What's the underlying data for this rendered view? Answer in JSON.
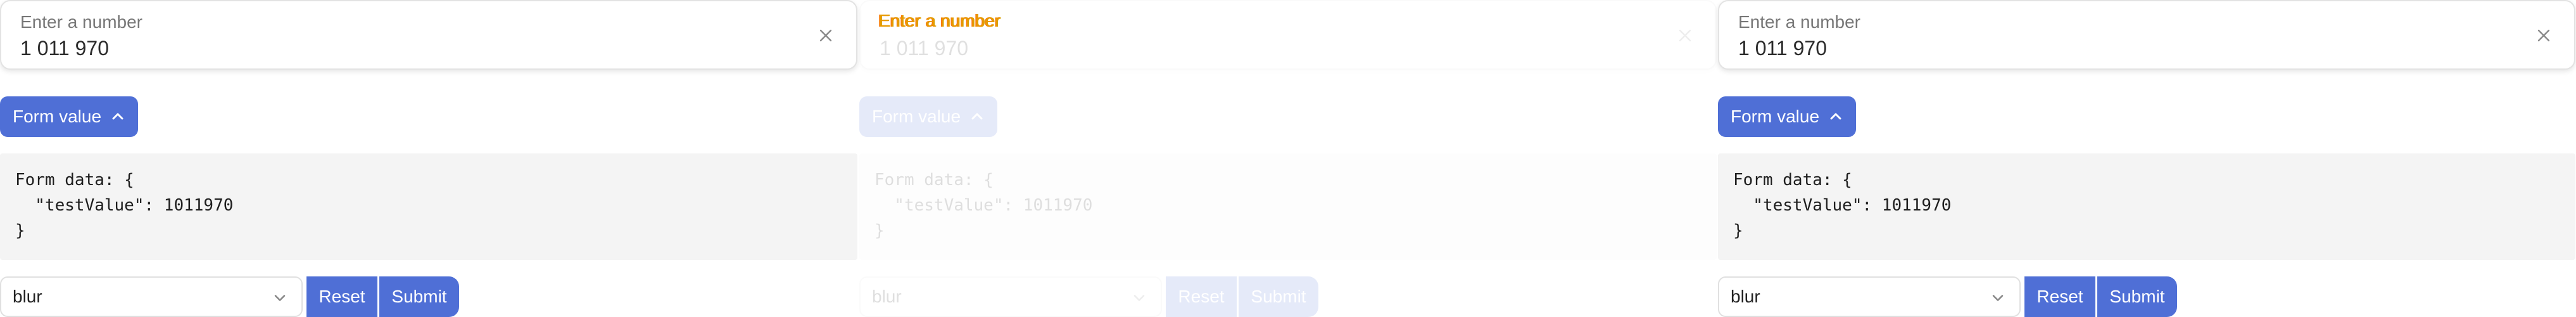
{
  "field": {
    "label": "Enter a number",
    "value": "1 011 970"
  },
  "toggle": {
    "label": "Form value"
  },
  "code": {
    "text": "Form data: {\n  \"testValue\": 1011970\n}"
  },
  "select": {
    "value": "blur"
  },
  "buttons": {
    "reset": "Reset",
    "submit": "Submit"
  },
  "icons": {
    "clear": "close-icon",
    "toggle": "chevron-up-icon",
    "select": "chevron-down-icon"
  },
  "colors": {
    "accent": "#4f6fd6",
    "code_bg": "#f4f4f4",
    "label_highlight": "#e89a00"
  }
}
